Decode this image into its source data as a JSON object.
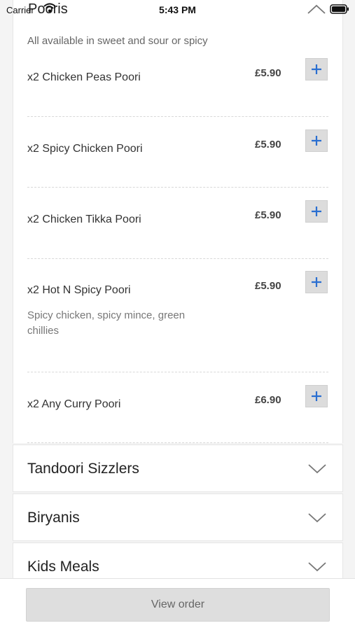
{
  "status_bar": {
    "carrier": "Carrier",
    "time": "5:43 PM"
  },
  "section": {
    "title": "Pooris",
    "subtitle": "All available in sweet and sour or spicy"
  },
  "items": [
    {
      "name": "x2 Chicken Peas Poori",
      "price": "£5.90",
      "description": ""
    },
    {
      "name": "x2 Spicy Chicken Poori",
      "price": "£5.90",
      "description": ""
    },
    {
      "name": "x2 Chicken Tikka Poori",
      "price": "£5.90",
      "description": ""
    },
    {
      "name": "x2 Hot N Spicy Poori",
      "price": "£5.90",
      "description": "Spicy chicken, spicy mince, green chillies"
    },
    {
      "name": "x2 Any Curry Poori",
      "price": "£6.90",
      "description": ""
    }
  ],
  "categories": [
    {
      "label": "Tandoori Sizzlers"
    },
    {
      "label": "Biryanis"
    },
    {
      "label": "Kids Meals"
    }
  ],
  "footer": {
    "view_order_label": "View order"
  },
  "colors": {
    "accent": "#2a6fd1",
    "add_button_bg": "#dcdcdc"
  },
  "icons": [
    "wifi-icon",
    "battery-icon",
    "chevron-up-icon",
    "plus-icon",
    "chevron-down-icon"
  ]
}
